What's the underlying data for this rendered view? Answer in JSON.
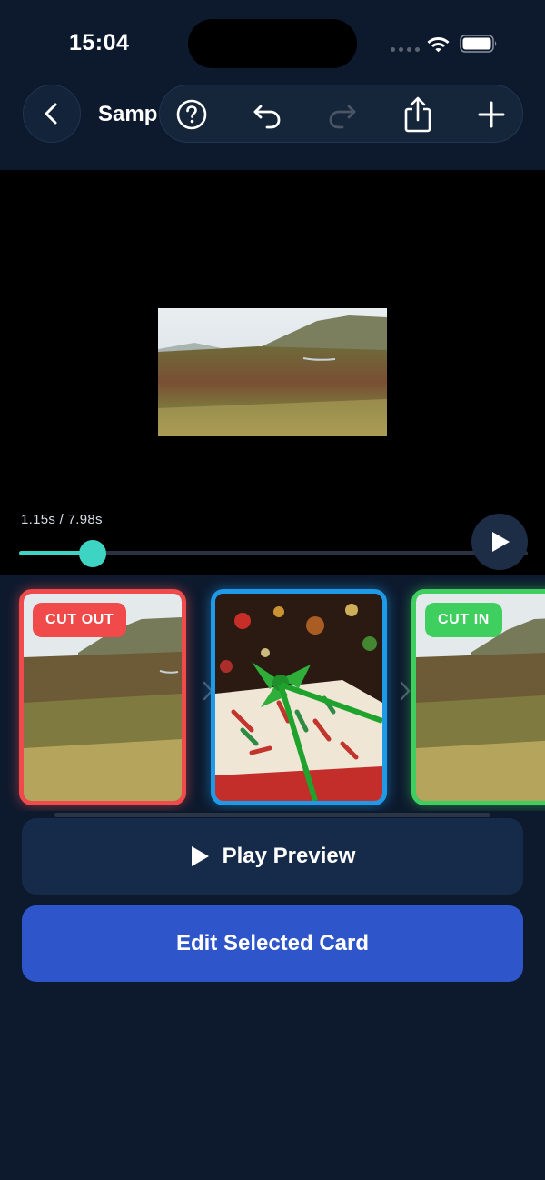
{
  "status_bar": {
    "time": "15:04"
  },
  "toolbar": {
    "title": "Samp",
    "icons": [
      "back-icon",
      "help-icon",
      "undo-icon",
      "redo-icon",
      "share-icon",
      "add-icon"
    ]
  },
  "player": {
    "time_readout": "1.15s / 7.98s",
    "progress": 0.144,
    "accent_color": "#3ed4c4"
  },
  "cards": [
    {
      "badge": "CUT OUT",
      "border_color": "#f04a4a",
      "image": "highland-landscape"
    },
    {
      "badge": "",
      "border_color": "#1f9ae8",
      "image": "christmas-gift"
    },
    {
      "badge": "CUT IN",
      "border_color": "#3fcf5f",
      "image": "highland-landscape"
    }
  ],
  "buttons": {
    "preview_label": "Play Preview",
    "edit_label": "Edit Selected Card"
  }
}
